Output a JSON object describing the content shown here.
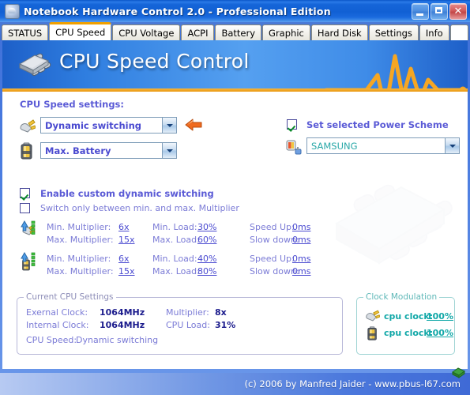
{
  "window": {
    "title": "Notebook Hardware Control 2.0  -  Professional Edition",
    "app_icon": "chip-icon",
    "minimize_label": "_",
    "maximize_label": "□",
    "close_label": "✕"
  },
  "tabs": [
    {
      "label": "STATUS",
      "active": false
    },
    {
      "label": "CPU Speed",
      "active": true
    },
    {
      "label": "CPU Voltage",
      "active": false
    },
    {
      "label": "ACPI",
      "active": false
    },
    {
      "label": "Battery",
      "active": false
    },
    {
      "label": "Graphic",
      "active": false
    },
    {
      "label": "Hard Disk",
      "active": false
    },
    {
      "label": "Settings",
      "active": false
    },
    {
      "label": "Info",
      "active": false
    }
  ],
  "banner": {
    "title": "CPU Speed Control",
    "icon": "cpu-chip-icon",
    "accent_color": "#f0a000",
    "gradient_color": "#55a0f0"
  },
  "cpu_speed_settings": {
    "heading": "CPU Speed settings:",
    "ac_mode": {
      "icon": "power-plug-icon",
      "value": "Dynamic switching"
    },
    "battery_mode": {
      "icon": "battery-icon",
      "value": "Max. Battery"
    },
    "arrow_icon": "orange-left-arrow-icon"
  },
  "power_scheme": {
    "checkbox_label": "Set selected Power Scheme",
    "checked": true,
    "icon": "power-scheme-icon",
    "value": "SAMSUNG"
  },
  "custom_switching": {
    "enable_label": "Enable custom dynamic switching",
    "enable_checked": true,
    "minmax_label": "Switch only between min. and max. Multiplier",
    "minmax_checked": false
  },
  "profiles": [
    {
      "icon": "ac-profile-icon",
      "rows": [
        {
          "label": "Min. Multiplier:",
          "value": "6x",
          "label2": "Min. Load:",
          "value2": "30%",
          "label3": "Speed Up:",
          "value3": "0ms"
        },
        {
          "label": "Max. Multiplier:",
          "value": "15x",
          "label2": "Max. Load:",
          "value2": "60%",
          "label3": "Slow down:",
          "value3": "0ms"
        }
      ]
    },
    {
      "icon": "battery-profile-icon",
      "rows": [
        {
          "label": "Min. Multiplier:",
          "value": "6x",
          "label2": "Min. Load:",
          "value2": "40%",
          "label3": "Speed Up:",
          "value3": "0ms"
        },
        {
          "label": "Max. Multiplier:",
          "value": "15x",
          "label2": "Max. Load:",
          "value2": "80%",
          "label3": "Slow down:",
          "value3": "0ms"
        }
      ]
    }
  ],
  "current_cpu_settings": {
    "legend": "Current CPU Settings",
    "external_clock_label": "Exernal Clock:",
    "external_clock_value": "1064MHz",
    "internal_clock_label": "Internal Clock:",
    "internal_clock_value": "1064MHz",
    "multiplier_label": "Multiplier:",
    "multiplier_value": "8x",
    "cpu_load_label": "CPU Load:",
    "cpu_load_value": "31%",
    "cpu_speed_label": "CPU Speed:",
    "cpu_speed_value": "Dynamic switching"
  },
  "clock_modulation": {
    "legend": "Clock Modulation",
    "accent_color": "#12a8a8",
    "rows": [
      {
        "icon": "power-plug-icon",
        "label": "cpu clock:",
        "value": "100%"
      },
      {
        "icon": "battery-icon",
        "label": "cpu clock:",
        "value": "100%"
      }
    ]
  },
  "footer": {
    "text": "(c) 2006 by Manfred Jaider  -  www.pbus-l67.com",
    "icon": "chip-icon"
  }
}
